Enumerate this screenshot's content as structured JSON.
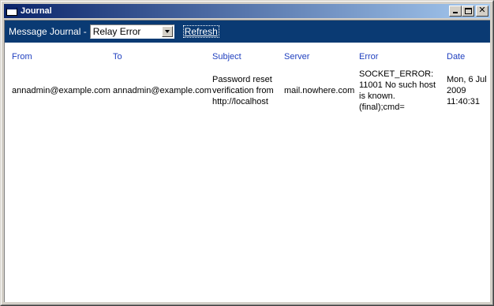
{
  "window": {
    "title": "Journal",
    "icon": "window-icon"
  },
  "toolbar": {
    "label": "Message Journal -",
    "journal_selected": "Relay Error",
    "refresh_label": "Refresh"
  },
  "table": {
    "headers": [
      "From",
      "To",
      "Subject",
      "Server",
      "Error",
      "Date"
    ],
    "rows": [
      {
        "from": "annadmin@example.com",
        "to": "annadmin@example.com",
        "subject": "Password reset verification from http://localhost",
        "server": "mail.nowhere.com",
        "error": "SOCKET_ERROR: 11001 No such host is known. (final);cmd=",
        "date": "Mon, 6 Jul 2009 11:40:31"
      }
    ]
  },
  "colors": {
    "titlebar_start": "#0a246a",
    "titlebar_end": "#a6caf0",
    "toolbar_bg": "#0a3a73",
    "header_text": "#1f3fbf"
  }
}
